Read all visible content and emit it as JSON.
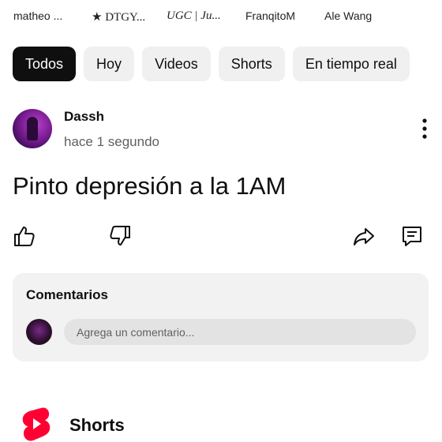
{
  "channels": [
    {
      "label": "matheo ..."
    },
    {
      "label": "★ DTGY..."
    },
    {
      "label": "UGC | Ju..."
    },
    {
      "label": "FranqitoM"
    },
    {
      "label": "Ale Wang"
    }
  ],
  "chips": [
    {
      "label": "Todos",
      "active": true
    },
    {
      "label": "Hoy"
    },
    {
      "label": "Videos"
    },
    {
      "label": "Shorts"
    },
    {
      "label": "En tiempo real"
    }
  ],
  "post": {
    "author": "Dassh",
    "time": "hace 1 segundo",
    "text": "Pinto depresión a la 1AM"
  },
  "comments": {
    "title": "Comentarios",
    "placeholder": "Agrega un comentario..."
  },
  "shorts": {
    "title": "Shorts"
  },
  "icons": {
    "like": "thumbs-up-icon",
    "dislike": "thumbs-down-icon",
    "share": "share-icon",
    "comment": "comment-icon",
    "menu": "more-vertical-icon",
    "shorts_logo": "shorts-logo-icon"
  },
  "colors": {
    "active_chip": "#0f0f0f",
    "chip": "#f0f0f0",
    "shorts_red": "#ff0033"
  }
}
